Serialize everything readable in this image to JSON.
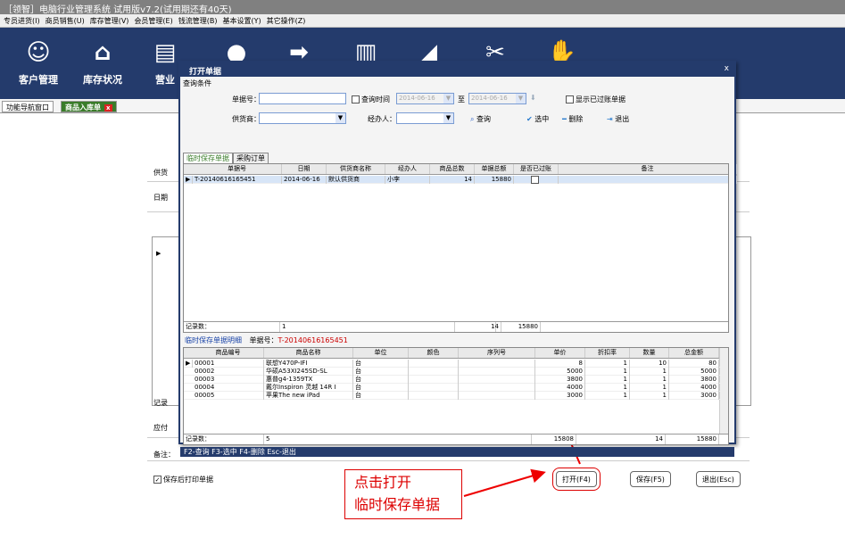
{
  "app_title": "［领智］电脑行业管理系统 试用版v7.2(试用期还有40天)",
  "menu": [
    "专员进货(I)",
    "商员销售(U)",
    "库存管理(V)",
    "会员管理(E)",
    "钱流管理(B)",
    "基本设置(Y)",
    "其它操作(Z)"
  ],
  "toolbar": [
    {
      "label": "客户管理",
      "icon": "user-circle-icon",
      "glyph": "☺"
    },
    {
      "label": "库存状况",
      "icon": "house-icon",
      "glyph": "⌂"
    },
    {
      "label": "营业",
      "icon": "ledger-icon",
      "glyph": "▤"
    },
    {
      "label": "",
      "icon": "chat-icon",
      "glyph": "●"
    },
    {
      "label": "",
      "icon": "arrow-icon",
      "glyph": "➡"
    },
    {
      "label": "",
      "icon": "barcode-icon",
      "glyph": "▥"
    },
    {
      "label": "",
      "icon": "send-icon",
      "glyph": "◢"
    },
    {
      "label": "",
      "icon": "tools-icon",
      "glyph": "✂"
    },
    {
      "label": "",
      "icon": "hand-icon",
      "glyph": "✋"
    }
  ],
  "tabs": {
    "nav": "功能导航窗口",
    "active": "商品入库单",
    "close": "x"
  },
  "background": {
    "supplier_label": "供货",
    "date_label": "日期",
    "record_label": "记录",
    "payable_label": "应付",
    "remark_label": "备注：",
    "print_label": "保存后打印单据",
    "open_btn": "打开(F4)",
    "save_btn": "保存(F5)",
    "exit_btn": "退出(Esc)"
  },
  "callout": {
    "line1": "点击打开",
    "line2": "临时保存单据"
  },
  "dialog": {
    "title": "打开单据",
    "close": "x",
    "query_group": "查询条件",
    "doc_no_label": "单据号：",
    "query_time_label": "查询时间",
    "date_from": "2014-06-16",
    "to_label": "至",
    "date_to": "2014-06-16",
    "show_posted_label": "显示已过账单据",
    "supplier_label": "供货商：",
    "handler_label": "经办人：",
    "query_btn": "查询",
    "select_btn": "选中",
    "delete_btn": "删除",
    "exit_btn": "退出",
    "subtab_temp": "临时保存单据",
    "subtab_purchase": "采购订单",
    "master": {
      "columns": [
        "单据号",
        "日期",
        "供货商名称",
        "经办人",
        "商品总数",
        "单据总额",
        "是否已过账",
        "备注"
      ],
      "rows": [
        [
          "T-20140616165451",
          "2014-06-16",
          "默认供货商",
          "小李",
          "14",
          "15880",
          "",
          ""
        ]
      ],
      "footer_label": "记录数：",
      "footer_count": "1",
      "footer_qty": "14",
      "footer_amount": "15880"
    },
    "detail_title": "临时保存单据明细",
    "detail_no_label": "单据号：",
    "detail_no": "T-20140616165451",
    "detail": {
      "columns": [
        "商品编号",
        "商品名称",
        "单位",
        "颜色",
        "序列号",
        "单价",
        "折扣率",
        "数量",
        "总金额"
      ],
      "rows": [
        [
          "00001",
          "联想Y470P-IFI",
          "台",
          "",
          "",
          "8",
          "1",
          "10",
          "80"
        ],
        [
          "00002",
          "华硕A53XI245SD-SL",
          "台",
          "",
          "",
          "5000",
          "1",
          "1",
          "5000"
        ],
        [
          "00003",
          "惠普g4-1359TX",
          "台",
          "",
          "",
          "3800",
          "1",
          "1",
          "3800"
        ],
        [
          "00004",
          "戴尔Inspiron 灵越 14R I",
          "台",
          "",
          "",
          "4000",
          "1",
          "1",
          "4000"
        ],
        [
          "00005",
          "苹果The new iPad",
          "台",
          "",
          "",
          "3000",
          "1",
          "1",
          "3000"
        ]
      ],
      "footer_label": "记录数：",
      "footer_count": "5",
      "footer_price": "15808",
      "footer_qty": "14",
      "footer_amount": "15880"
    },
    "status": "F2-查询 F3-选中 F4-删除 Esc-退出"
  }
}
